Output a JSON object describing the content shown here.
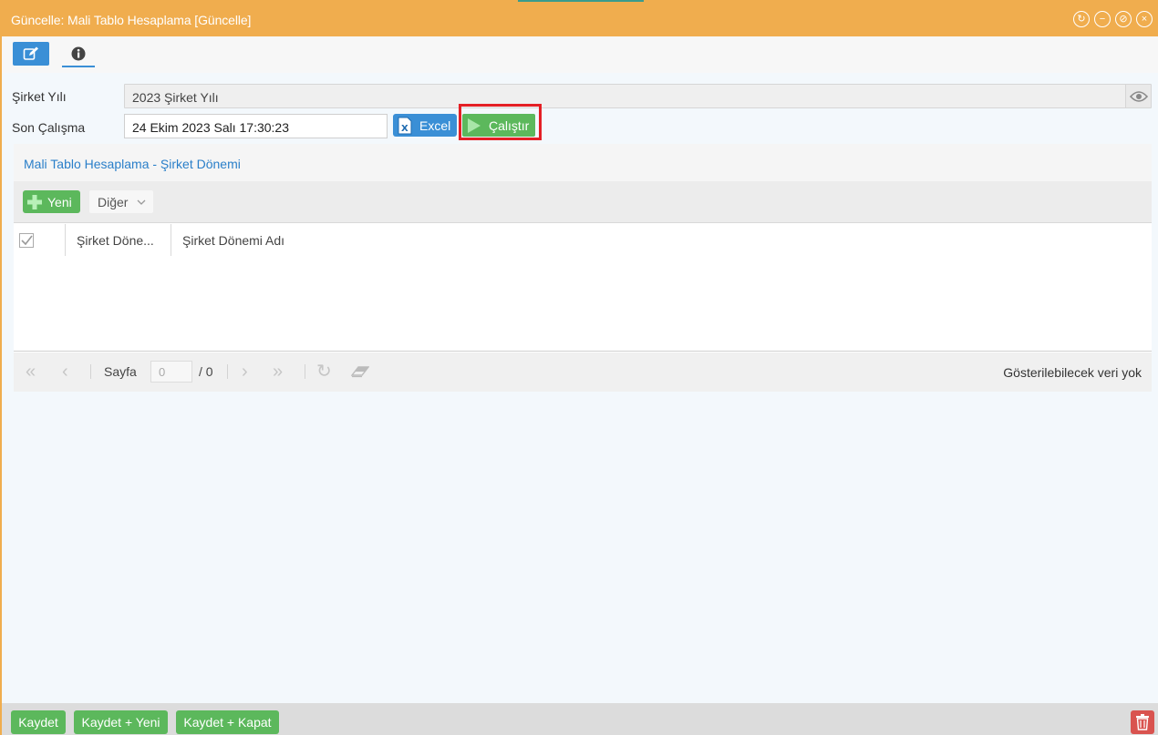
{
  "window": {
    "title": "Güncelle: Mali Tablo Hesaplama [Güncelle]",
    "controls": [
      {
        "name": "refresh-icon",
        "glyph": "↻"
      },
      {
        "name": "minimize-icon",
        "glyph": "−"
      },
      {
        "name": "restore-icon",
        "glyph": "⊘"
      },
      {
        "name": "close-icon",
        "glyph": "×"
      }
    ],
    "accent_color": "#f0ad4e"
  },
  "tabs": [
    {
      "icon": "edit-icon",
      "active": true
    },
    {
      "icon": "info-icon",
      "active": false
    }
  ],
  "form": {
    "company_year": {
      "label": "Şirket Yılı",
      "value": "2023 Şirket Yılı"
    },
    "last_run": {
      "label": "Son Çalışma",
      "value": "24 Ekim 2023 Salı 17:30:23"
    },
    "excel_label": "Excel",
    "run_label": "Çalıştır"
  },
  "panel": {
    "title": "Mali Tablo Hesaplama - Şirket Dönemi",
    "new_label": "Yeni",
    "other_label": "Diğer",
    "columns": [
      "Şirket Döne...",
      "Şirket Dönemi Adı"
    ],
    "pager": {
      "page_label": "Sayfa",
      "page_value": "0",
      "page_total": "/ 0",
      "empty_message": "Gösterilebilecek veri yok"
    }
  },
  "footer": {
    "save_label": "Kaydet",
    "save_new_label": "Kaydet + Yeni",
    "save_close_label": "Kaydet + Kapat"
  },
  "colors": {
    "primary": "#3a8fd6",
    "success": "#5cb85c",
    "danger": "#d9534f",
    "highlight": "#e41f25"
  }
}
